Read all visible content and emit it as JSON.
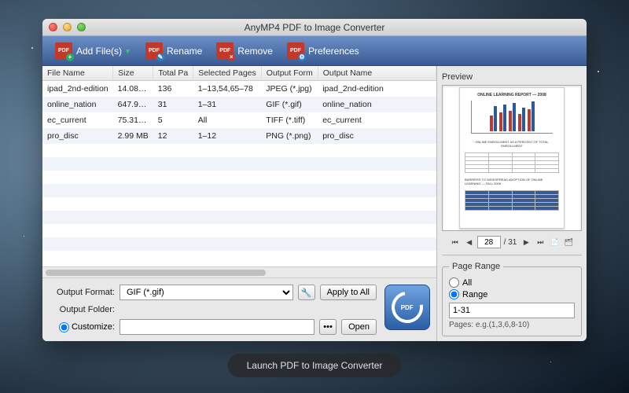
{
  "window": {
    "title": "AnyMP4 PDF to Image Converter"
  },
  "toolbar": {
    "add": "Add File(s)",
    "rename": "Rename",
    "remove": "Remove",
    "prefs": "Preferences"
  },
  "columns": {
    "name": "File Name",
    "size": "Size",
    "total": "Total Pa",
    "selected": "Selected Pages",
    "outfmt": "Output Form",
    "outname": "Output Name"
  },
  "files": [
    {
      "name": "ipad_2nd-edition",
      "size": "14.08…",
      "total": "136",
      "selected": "1–13,54,65–78",
      "outfmt": "JPEG (*.jpg)",
      "outname": "ipad_2nd-edition"
    },
    {
      "name": "online_nation",
      "size": "647.9…",
      "total": "31",
      "selected": "1–31",
      "outfmt": "GIF (*.gif)",
      "outname": "online_nation"
    },
    {
      "name": "ec_current",
      "size": "75.31…",
      "total": "5",
      "selected": "All",
      "outfmt": "TIFF (*.tiff)",
      "outname": "ec_current"
    },
    {
      "name": "pro_disc",
      "size": "2.99 MB",
      "total": "12",
      "selected": "1–12",
      "outfmt": "PNG (*.png)",
      "outname": "pro_disc"
    }
  ],
  "output": {
    "format_label": "Output Format:",
    "format_value": "GIF (*.gif)",
    "apply_all": "Apply to All",
    "folder_label": "Output Folder:",
    "customize": "Customize:",
    "browse": "•••",
    "open": "Open"
  },
  "preview": {
    "label": "Preview",
    "current": "28",
    "total": "/ 31"
  },
  "page_range": {
    "legend": "Page Range",
    "all": "All",
    "range": "Range",
    "range_value": "1-31",
    "hint": "Pages: e.g.(1,3,6,8-10)"
  },
  "launch": "Launch PDF to Image Converter"
}
